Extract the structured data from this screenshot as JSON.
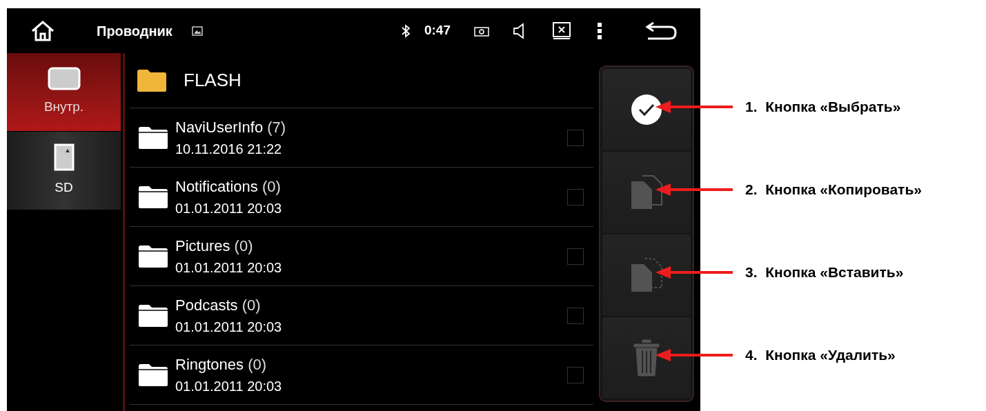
{
  "status_bar": {
    "title": "Проводник",
    "time": "0:47"
  },
  "sidebar": {
    "items": [
      {
        "label": "Внутр.",
        "kind": "internal",
        "selected": true
      },
      {
        "label": "SD",
        "kind": "sd",
        "selected": false
      }
    ]
  },
  "folder": {
    "name": "FLASH"
  },
  "files": [
    {
      "name": "NaviUserInfo",
      "count": "(7)",
      "date": "10.11.2016 21:22",
      "checked": false
    },
    {
      "name": "Notifications",
      "count": "(0)",
      "date": "01.01.2011 20:03",
      "checked": false
    },
    {
      "name": "Pictures",
      "count": "(0)",
      "date": "01.01.2011 20:03",
      "checked": false
    },
    {
      "name": "Podcasts",
      "count": "(0)",
      "date": "01.01.2011 20:03",
      "checked": false
    },
    {
      "name": "Ringtones",
      "count": "(0)",
      "date": "01.01.2011 20:03",
      "checked": false
    }
  ],
  "actions": [
    {
      "kind": "select",
      "disabled": false
    },
    {
      "kind": "copy",
      "disabled": true
    },
    {
      "kind": "paste",
      "disabled": true
    },
    {
      "kind": "delete",
      "disabled": true
    }
  ],
  "annotations": [
    {
      "number": "1.",
      "text": "Кнопка «Выбрать»"
    },
    {
      "number": "2.",
      "text": "Кнопка «Копировать»"
    },
    {
      "number": "3.",
      "text": "Кнопка «Вставить»"
    },
    {
      "number": "4.",
      "text": "Кнопка «Удалить»"
    }
  ]
}
